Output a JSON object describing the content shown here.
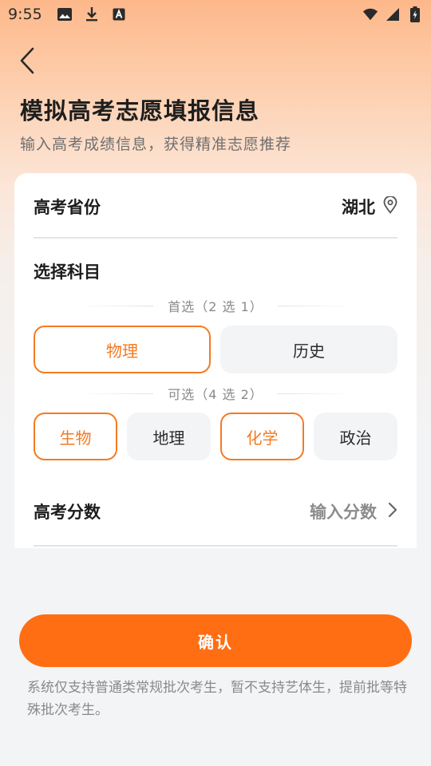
{
  "status_bar": {
    "time": "9:55",
    "left_icons": [
      "image-icon",
      "download-icon",
      "text-a-icon"
    ],
    "right_icons": [
      "wifi-icon",
      "signal-icon",
      "battery-charging-icon"
    ]
  },
  "header": {
    "back_icon": "chevron-left-icon",
    "title": "模拟高考志愿填报信息",
    "subtitle": "输入高考成绩信息，获得精准志愿推荐"
  },
  "form": {
    "province": {
      "label": "高考省份",
      "value": "湖北",
      "icon": "location-pin-icon"
    },
    "subjects": {
      "label": "选择科目",
      "primary": {
        "caption": "首选（2 选 1）",
        "options": [
          {
            "label": "物理",
            "selected": true
          },
          {
            "label": "历史",
            "selected": false
          }
        ]
      },
      "optional": {
        "caption": "可选（4 选 2）",
        "options": [
          {
            "label": "生物",
            "selected": true
          },
          {
            "label": "地理",
            "selected": false
          },
          {
            "label": "化学",
            "selected": true
          },
          {
            "label": "政治",
            "selected": false
          }
        ]
      }
    },
    "score": {
      "label": "高考分数",
      "placeholder": "输入分数",
      "icon": "chevron-right-icon"
    }
  },
  "confirm_label": "确认",
  "notice": "系统仅支持普通类常规批次考生，暂不支持艺体生，提前批等特殊批次考生。",
  "colors": {
    "accent": "#ff6e12",
    "selected_border": "#f47a22"
  }
}
